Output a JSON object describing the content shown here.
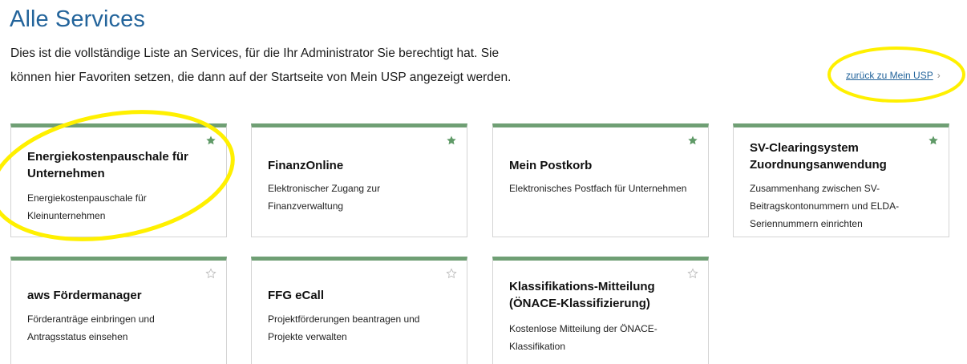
{
  "header": {
    "title": "Alle Services",
    "intro_line1": "Dies ist die vollständige Liste an Services, für die Ihr Administrator Sie berechtigt hat. Sie",
    "intro_line2": "können hier Favoriten setzen, die dann auf der Startseite von Mein USP angezeigt werden."
  },
  "back_link": {
    "label": "zurück zu Mein USP",
    "chevron": "›"
  },
  "cards": [
    {
      "title": "Energiekostenpauschale für Unternehmen",
      "description": "Energiekostenpauschale für Kleinunternehmen",
      "favorite": true
    },
    {
      "title": "FinanzOnline",
      "description": "Elektronischer Zugang zur Finanzverwaltung",
      "favorite": true
    },
    {
      "title": "Mein Postkorb",
      "description": "Elektronisches Postfach für Unternehmen",
      "favorite": true
    },
    {
      "title": "SV-Clearingsystem Zuordnungsanwendung",
      "description": "Zusammenhang zwischen SV-Beitragskontonummern und ELDA-Seriennummern einrichten",
      "favorite": true
    },
    {
      "title": "aws Fördermanager",
      "description": "Förderanträge einbringen und Antragsstatus einsehen",
      "favorite": false
    },
    {
      "title": "FFG eCall",
      "description": "Projektförderungen beantragen und Projekte verwalten",
      "favorite": false
    },
    {
      "title": "Klassifikations-Mitteilung (ÖNACE-Klassifizierung)",
      "description": "Kostenlose Mitteilung der ÖNACE-Klassifikation",
      "favorite": false
    }
  ],
  "icons": {
    "favorite_on": "star-filled-icon",
    "favorite_off": "star-outline-icon"
  },
  "colors": {
    "title_blue": "#23649b",
    "card_accent_green": "#6f9f74",
    "star_green": "#5f9a67",
    "annotation_yellow": "#fff000"
  }
}
